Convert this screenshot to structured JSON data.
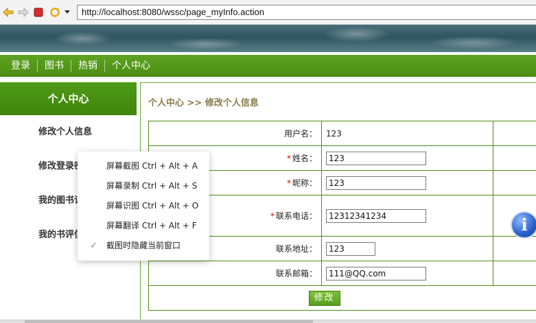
{
  "browser": {
    "url": "http://localhost:8080/wssc/page_myInfo.action"
  },
  "nav": {
    "items": [
      "登录",
      "图书",
      "热销",
      "个人中心"
    ]
  },
  "sidebar": {
    "title": "个人中心",
    "items": [
      "修改个人信息",
      "修改登录密码",
      "我的图书订单",
      "我的书评信息"
    ]
  },
  "breadcrumb": "个人中心 >> 修改个人信息",
  "form": {
    "username_label": "用户名：",
    "username_value": "123",
    "realname_label": "姓名：",
    "realname_value": "123",
    "nickname_label": "昵称：",
    "nickname_value": "123",
    "phone_label": "联系电话：",
    "phone_value": "12312341234",
    "address_label": "联系地址：",
    "address_value": "123",
    "email_label": "联系邮箱：",
    "email_value": "111@QQ.com",
    "required_mark": "*",
    "submit_label": "修改"
  },
  "context_menu": {
    "items": [
      "屏幕截图 Ctrl + Alt + A",
      "屏幕录制 Ctrl + Alt + S",
      "屏幕识图 Ctrl + Alt + O",
      "屏幕翻译 Ctrl + Alt + F",
      "截图时隐藏当前窗口"
    ],
    "checked_index": 4
  },
  "colors": {
    "nav_green": "#4a8d12",
    "breadcrumb": "#8a7a4a",
    "required": "#dd0000"
  }
}
